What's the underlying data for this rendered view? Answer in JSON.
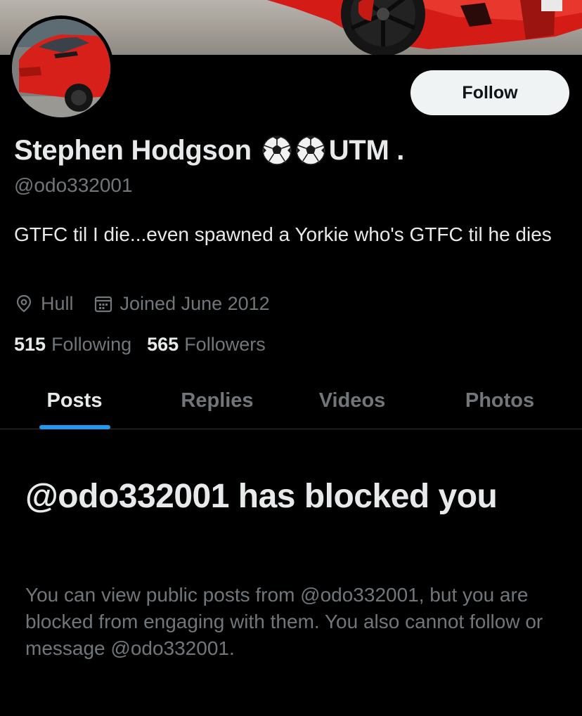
{
  "header": {
    "follow_label": "Follow"
  },
  "profile": {
    "name": "Stephen Hodgson",
    "name_icons": [
      "soccer-ball-icon",
      "soccer-ball-icon"
    ],
    "name_suffix": "UTM .",
    "handle": "@odo332001",
    "bio": "GTFC til I die...even spawned a Yorkie who's GTFC til he dies",
    "location": "Hull",
    "joined": "Joined June 2012",
    "following_count": "515",
    "following_label": "Following",
    "followers_count": "565",
    "followers_label": "Followers"
  },
  "tabs": [
    {
      "label": "Posts",
      "active": true
    },
    {
      "label": "Replies",
      "active": false
    },
    {
      "label": "Videos",
      "active": false
    },
    {
      "label": "Photos",
      "active": false
    }
  ],
  "blocked": {
    "title": "@odo332001 has blocked you",
    "body": "You can view public posts from @odo332001, but you are blocked from engaging with them. You also cannot follow or message @odo332001."
  },
  "colors": {
    "background": "#000000",
    "accent": "#1d9bf0",
    "text_primary": "#e7e9ea",
    "text_secondary": "#71767b"
  }
}
